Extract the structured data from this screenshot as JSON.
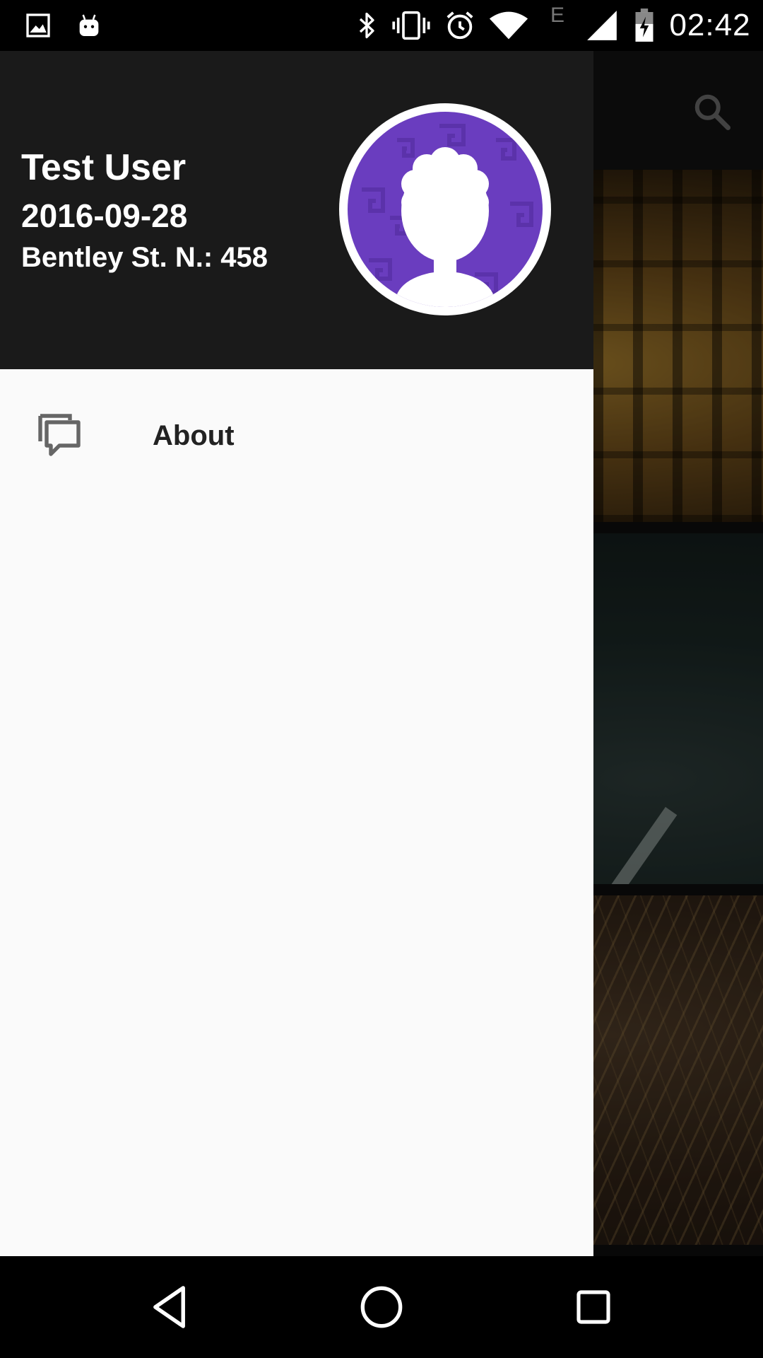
{
  "status_bar": {
    "time": "02:42",
    "network_type": "E",
    "icons": [
      "image-notification-icon",
      "android-notification-icon",
      "bluetooth-icon",
      "vibrate-icon",
      "alarm-icon",
      "wifi-icon",
      "network-type-indicator",
      "cellular-signal-icon",
      "battery-charging-icon"
    ]
  },
  "drawer": {
    "header": {
      "name": "Test User",
      "date": "2016-09-28",
      "address": "Bentley St. N.: 458",
      "avatar_color": "#6a3dbf"
    },
    "menu": [
      {
        "label": "About",
        "icon": "chat-bubbles-icon"
      }
    ]
  },
  "toolbar": {
    "search_icon": "search-icon"
  },
  "navigation_bar": {
    "buttons": [
      "back-icon",
      "home-icon",
      "recents-icon"
    ]
  },
  "colors": {
    "drawer_header_bg": "#1a1a1a",
    "drawer_bg": "#fafafa",
    "avatar_bg": "#6a3dbf"
  }
}
